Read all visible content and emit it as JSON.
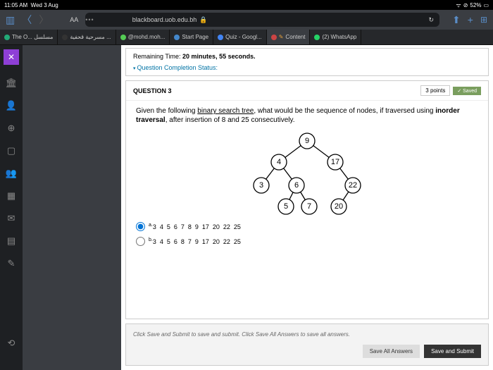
{
  "status": {
    "time": "11:05 AM",
    "date": "Wed 3 Aug",
    "battery": "52%"
  },
  "browser": {
    "aa": "AA",
    "url": "blackboard.uob.edu.bh"
  },
  "tabs": [
    {
      "label": "The O... مسلسل"
    },
    {
      "label": "مسرحية قحفية ..."
    },
    {
      "label": "@mohd.moh..."
    },
    {
      "label": "Start Page"
    },
    {
      "label": "Quiz - Googl..."
    },
    {
      "label": "Content"
    },
    {
      "label": "(2) WhatsApp"
    }
  ],
  "quiz": {
    "remaining_label": "Remaining Time:",
    "remaining_value": "20 minutes, 55 seconds.",
    "completion": "Question Completion Status:",
    "qnum": "QUESTION 3",
    "points": "3 points",
    "saved": "✓ Saved",
    "prompt_1": "Given the following ",
    "prompt_u": "binary search tree",
    "prompt_2": ", what would be the sequence of nodes, if traversed using ",
    "prompt_b": "inorder traversal",
    "prompt_3": ", after insertion of 8 and 25 consecutively.",
    "tree": {
      "n1": "9",
      "n2": "4",
      "n3": "17",
      "n4": "3",
      "n5": "6",
      "n6": "22",
      "n7": "5",
      "n8": "7",
      "n9": "20"
    },
    "opts": {
      "a_label": "a.",
      "a": "3  4  5  6  7  8  9  17  20  22  25",
      "b_label": "b.",
      "b": "3  4  5  6  8  7  9  17  20  22  25"
    },
    "footer": "Click Save and Submit to save and submit. Click Save All Answers to save all answers.",
    "btn_all": "Save All Answers",
    "btn_submit": "Save and Submit"
  }
}
